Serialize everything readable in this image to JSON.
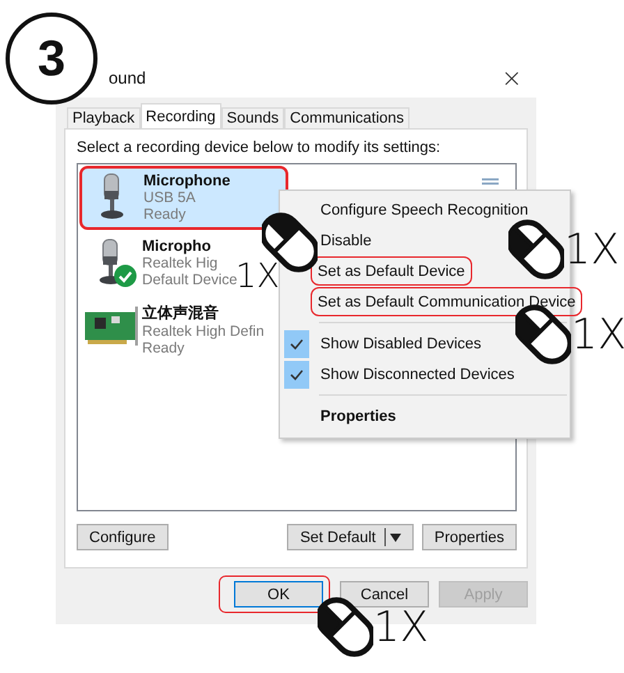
{
  "step": "3",
  "window": {
    "title": "ound",
    "close": "×"
  },
  "tabs": [
    {
      "label": "Playback",
      "selected": false
    },
    {
      "label": "Recording",
      "selected": true
    },
    {
      "label": "Sounds",
      "selected": false
    },
    {
      "label": "Communications",
      "selected": false
    }
  ],
  "instruction": "Select a recording device below to modify its settings:",
  "devices": [
    {
      "kind": "usb-mic",
      "name": "Microphone",
      "lines": [
        "USB 5A",
        "Ready"
      ],
      "selected": true,
      "highlighted": true,
      "default": false
    },
    {
      "kind": "usb-mic",
      "name": "Micropho",
      "lines": [
        "Realtek Hig",
        "Default Device"
      ],
      "selected": false,
      "highlighted": false,
      "default": true
    },
    {
      "kind": "sound-card",
      "name": "立体声混音",
      "lines": [
        "Realtek High Defin",
        "Ready"
      ],
      "selected": false,
      "highlighted": false,
      "default": false
    }
  ],
  "panel_buttons": [
    {
      "label": "Configure",
      "split": false
    },
    {
      "label": "Set Default",
      "split": true
    },
    {
      "label": "Properties",
      "split": false
    }
  ],
  "dialog_buttons": [
    {
      "label": "OK",
      "default": true,
      "highlighted": true,
      "disabled": false
    },
    {
      "label": "Cancel",
      "default": false,
      "highlighted": false,
      "disabled": false
    },
    {
      "label": "Apply",
      "default": false,
      "highlighted": false,
      "disabled": true
    }
  ],
  "context_menu": [
    {
      "kind": "item",
      "label": "Configure Speech Recognition",
      "checked": false,
      "highlighted": false,
      "bold": false
    },
    {
      "kind": "item",
      "label": "Disable",
      "checked": false,
      "highlighted": false,
      "bold": false
    },
    {
      "kind": "item",
      "label": "Set as Default Device",
      "checked": false,
      "highlighted": true,
      "bold": false
    },
    {
      "kind": "item",
      "label": "Set as Default Communication Device",
      "checked": false,
      "highlighted": true,
      "bold": false
    },
    {
      "kind": "separator"
    },
    {
      "kind": "item",
      "label": "Show Disabled Devices",
      "checked": true,
      "highlighted": false,
      "bold": false
    },
    {
      "kind": "item",
      "label": "Show Disconnected Devices",
      "checked": true,
      "highlighted": false,
      "bold": false
    },
    {
      "kind": "separator"
    },
    {
      "kind": "item",
      "label": "Properties",
      "checked": false,
      "highlighted": false,
      "bold": true
    }
  ],
  "annotations": [
    {
      "kind": "right-click",
      "count": "1X"
    },
    {
      "kind": "left-click",
      "count": "1X"
    },
    {
      "kind": "left-click",
      "count": "1X"
    },
    {
      "kind": "left-click",
      "count": "1X"
    }
  ]
}
